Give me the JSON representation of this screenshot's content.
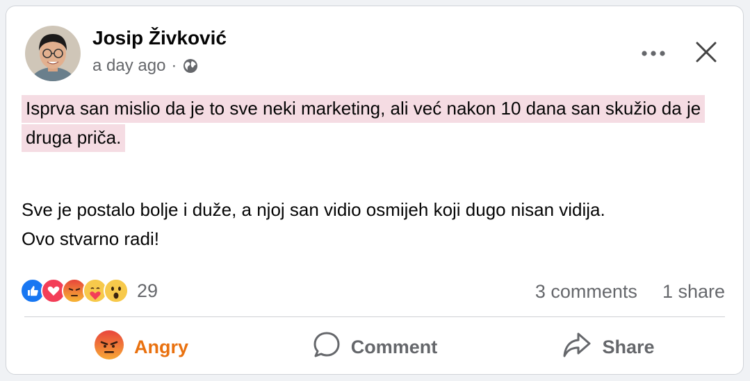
{
  "post": {
    "author": "Josip Živković",
    "time": "a day ago",
    "separator": "·",
    "audience_icon": "globe-icon",
    "highlighted_text": "Isprva san mislio da je to sve neki marketing, ali već nakon 10 dana san skužio da je druga priča.",
    "body_line_1": "Sve je postalo bolje i duže, a njoj san vidio osmijeh koji dugo nisan vidija.",
    "body_line_2": "Ovo stvarno radi!",
    "highlight_color": "#f5dce3"
  },
  "reactions": {
    "icons": [
      "like-icon",
      "love-icon",
      "angry-icon",
      "care-icon",
      "wow-icon"
    ],
    "count": "29",
    "comments": "3 comments",
    "shares": "1 share"
  },
  "actions": {
    "react_label": "Angry",
    "comment_label": "Comment",
    "share_label": "Share",
    "react_color": "#e9710f"
  }
}
